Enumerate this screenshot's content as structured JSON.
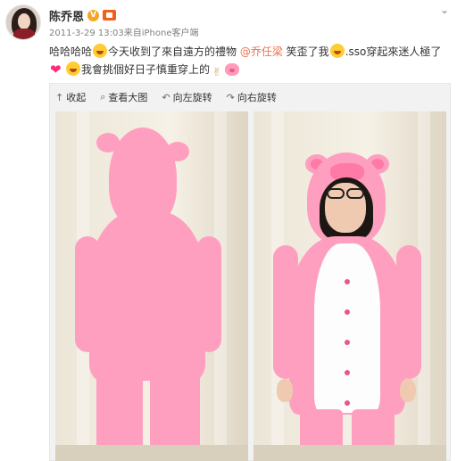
{
  "user": {
    "name": "陈乔恩",
    "verified_badge": "V"
  },
  "meta": {
    "time": "2011-3-29 13:03",
    "source": "来自iPhone客户端"
  },
  "post": {
    "t1": "哈哈哈哈",
    "t2": "今天收到了來自遠方的禮物 ",
    "mention": "@乔任梁",
    "t3": " 笑歪了我",
    "t4": ".sso穿起來迷人極了",
    "t5": "我會挑個好日子慎重穿上的"
  },
  "toolbar": {
    "collect": "收起",
    "view_large": "查看大图",
    "rotate_left": "向左旋转",
    "rotate_right": "向右旋转"
  },
  "icons": {
    "more": "chevron-down-icon",
    "collect": "collapse-icon",
    "view_large": "magnifier-icon",
    "rotate_left": "rotate-left-icon",
    "rotate_right": "rotate-right-icon"
  },
  "colors": {
    "link": "#eb7350",
    "suit_pink": "#ff9fbf",
    "badge": "#f5a623"
  }
}
